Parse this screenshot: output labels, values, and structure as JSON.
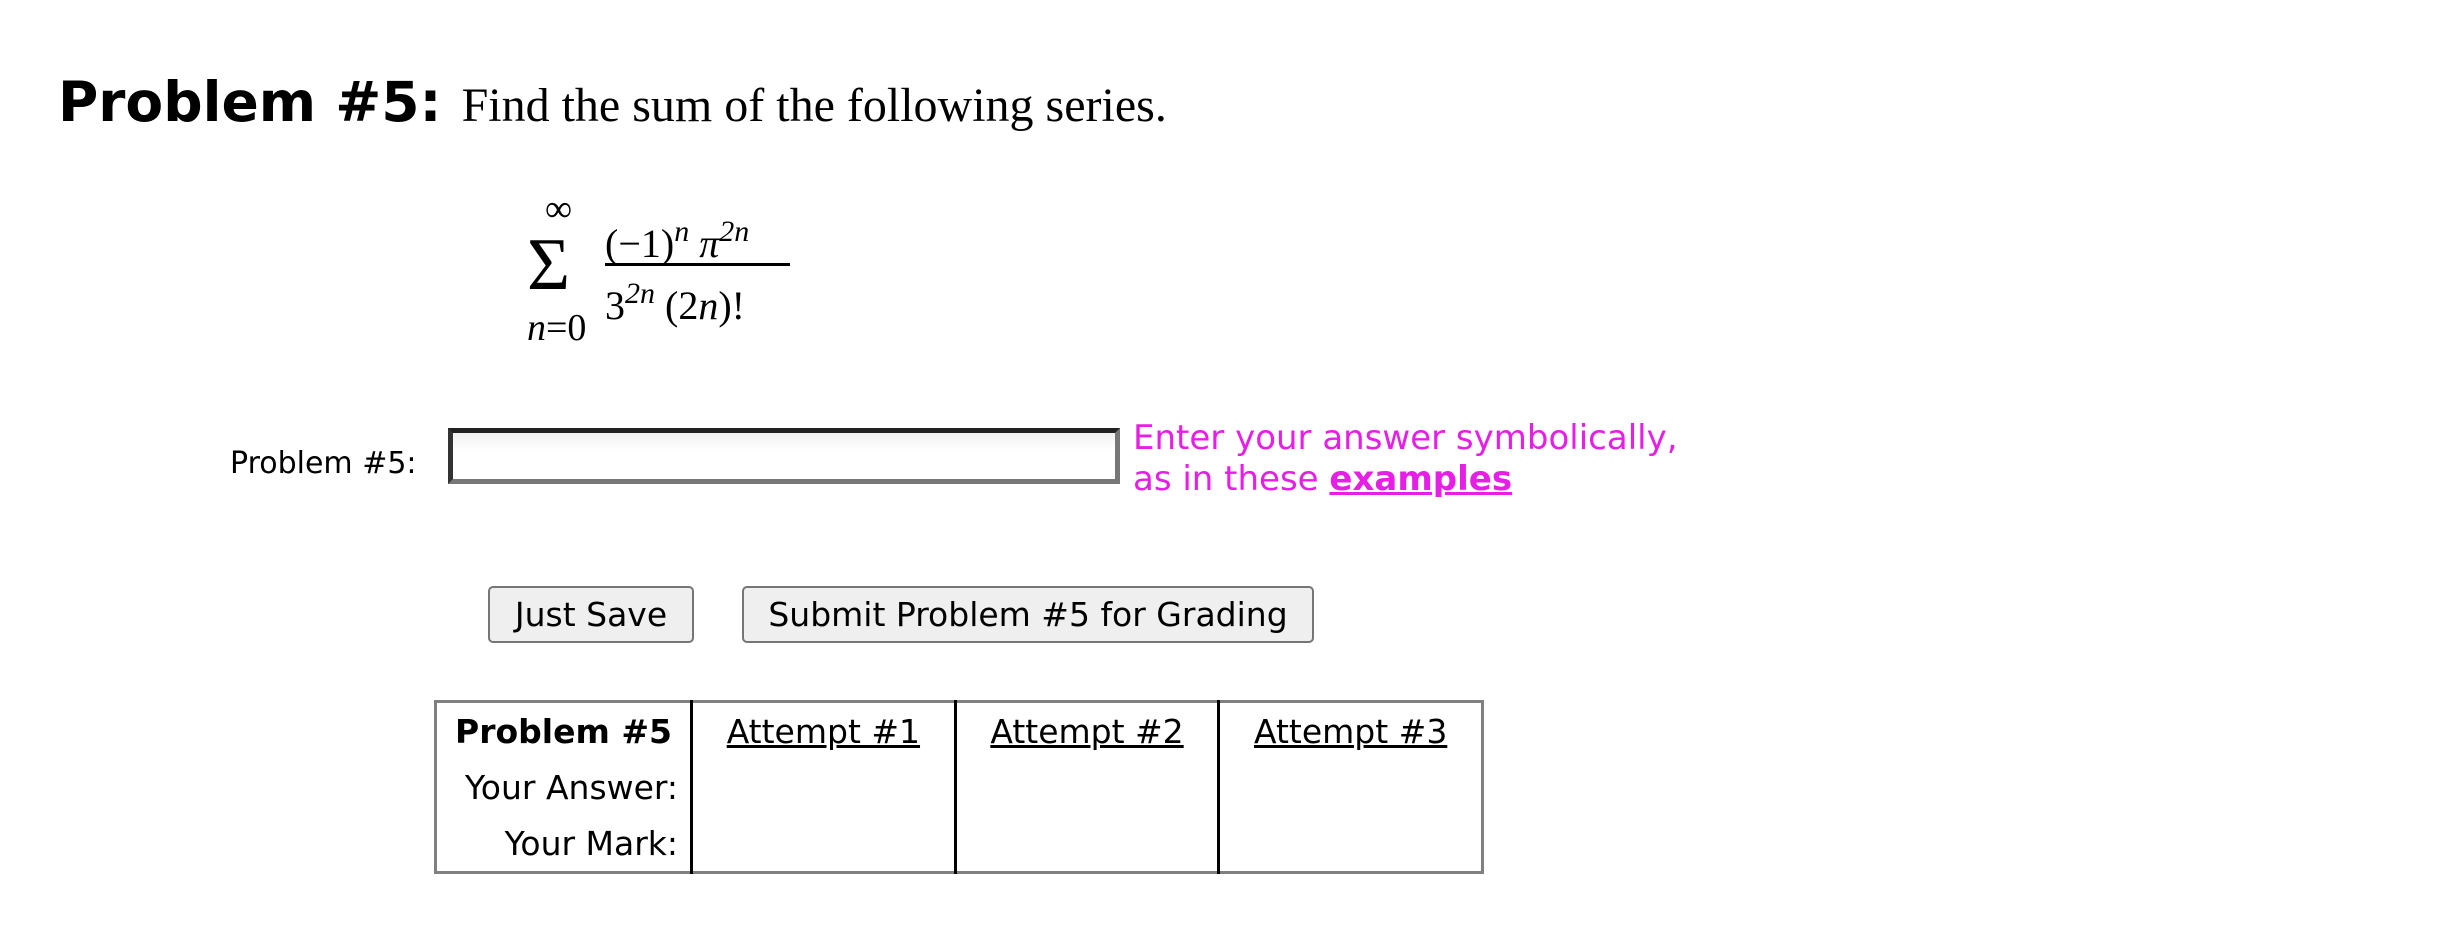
{
  "problem": {
    "heading_label": "Problem #5:",
    "heading_text": "Find the sum of the following series.",
    "formula": {
      "upper_limit": "∞",
      "sigma": "Σ",
      "lower_limit_var": "n",
      "lower_limit_eq": "=0",
      "num_base": "(−1)",
      "num_exp": "n",
      "num_pi": "π",
      "num_pi_exp": "2n",
      "den_base": "3",
      "den_exp": "2n",
      "den_fact_open": "(2",
      "den_fact_var": "n",
      "den_fact_close": ")!"
    }
  },
  "answer": {
    "label": "Problem #5:",
    "value": "",
    "hint_line1": "Enter your answer symbolically,",
    "hint_line2": "as in these ",
    "hint_link": "examples"
  },
  "buttons": {
    "save_label": "Just Save",
    "submit_label": "Submit Problem #5 for Grading"
  },
  "attempts_table": {
    "header": "Problem #5",
    "attempts": [
      "Attempt #1",
      "Attempt #2",
      "Attempt #3"
    ],
    "row_answer_label": "Your Answer:",
    "row_mark_label": "Your Mark:"
  }
}
